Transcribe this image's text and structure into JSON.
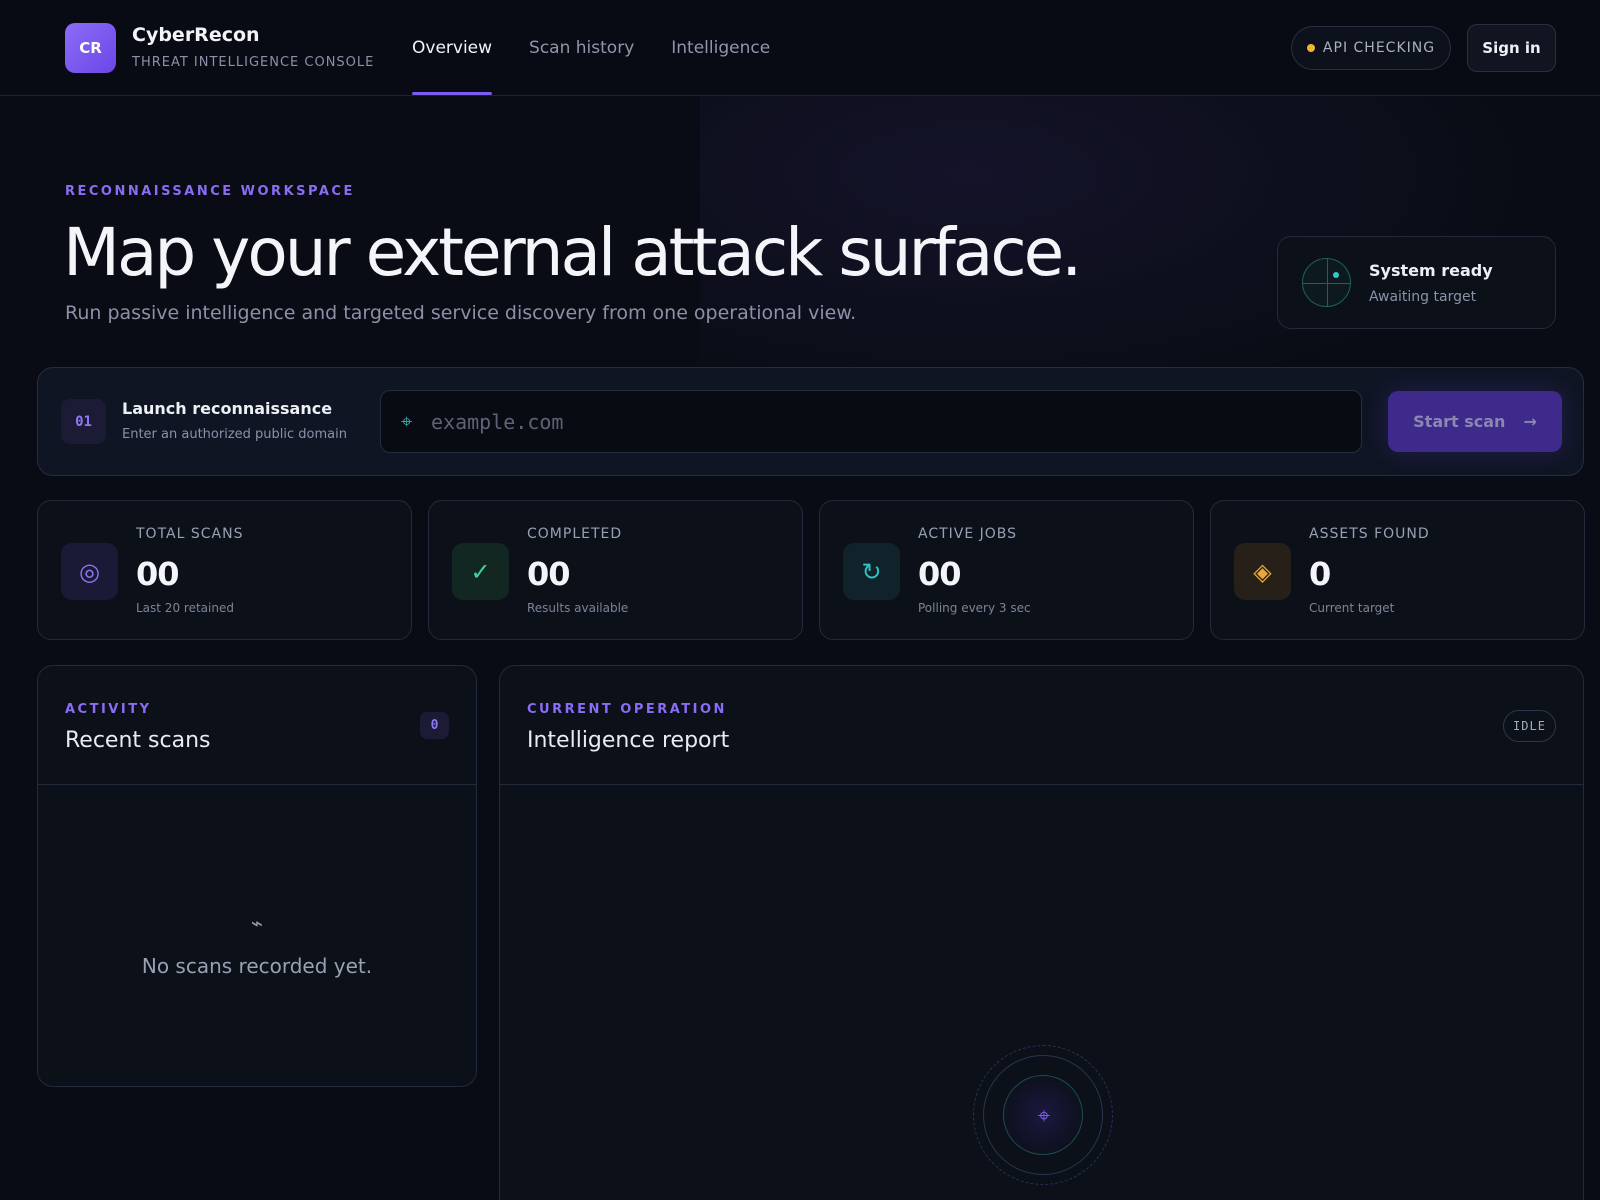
{
  "header": {
    "logo_text": "CR",
    "brand_name": "CyberRecon",
    "brand_sub": "THREAT INTELLIGENCE CONSOLE",
    "nav": [
      {
        "label": "Overview",
        "active": true
      },
      {
        "label": "Scan history",
        "active": false
      },
      {
        "label": "Intelligence",
        "active": false
      }
    ],
    "api_status": "API CHECKING",
    "api_status_color": "#f2b336",
    "signin_label": "Sign in"
  },
  "hero": {
    "eyebrow": "RECONNAISSANCE WORKSPACE",
    "title": "Map your external attack surface.",
    "subtitle": "Run passive intelligence and targeted service discovery from one operational view.",
    "status_card": {
      "title": "System ready",
      "subtitle": "Awaiting target"
    }
  },
  "launch": {
    "step": "01",
    "title": "Launch reconnaissance",
    "subtitle": "Enter an authorized public domain",
    "input_icon": "target-icon",
    "input_value": "",
    "input_placeholder": "example.com",
    "button_label": "Start scan",
    "button_arrow": "→"
  },
  "stats": [
    {
      "label": "TOTAL SCANS",
      "value": "00",
      "note": "Last 20 retained",
      "icon": "◎",
      "icon_name": "target-circle-icon",
      "icon_color": "#8f78f5",
      "icon_bg": "#1b1a36"
    },
    {
      "label": "COMPLETED",
      "value": "00",
      "note": "Results available",
      "icon": "✓",
      "icon_name": "check-icon",
      "icon_color": "#3ed598",
      "icon_bg": "#122622"
    },
    {
      "label": "ACTIVE JOBS",
      "value": "00",
      "note": "Polling every 3 sec",
      "icon": "↻",
      "icon_name": "refresh-icon",
      "icon_color": "#2fc2c0",
      "icon_bg": "#10232a"
    },
    {
      "label": "ASSETS FOUND",
      "value": "0",
      "note": "Current target",
      "icon": "◈",
      "icon_name": "diamond-icon",
      "icon_color": "#e8a73a",
      "icon_bg": "#262018"
    }
  ],
  "activity": {
    "eyebrow": "ACTIVITY",
    "title": "Recent scans",
    "count": "0",
    "empty_icon": "⌁",
    "empty_text": "No scans recorded yet."
  },
  "operation": {
    "eyebrow": "CURRENT OPERATION",
    "title": "Intelligence report",
    "status": "IDLE",
    "scope_icon": "⌖"
  }
}
